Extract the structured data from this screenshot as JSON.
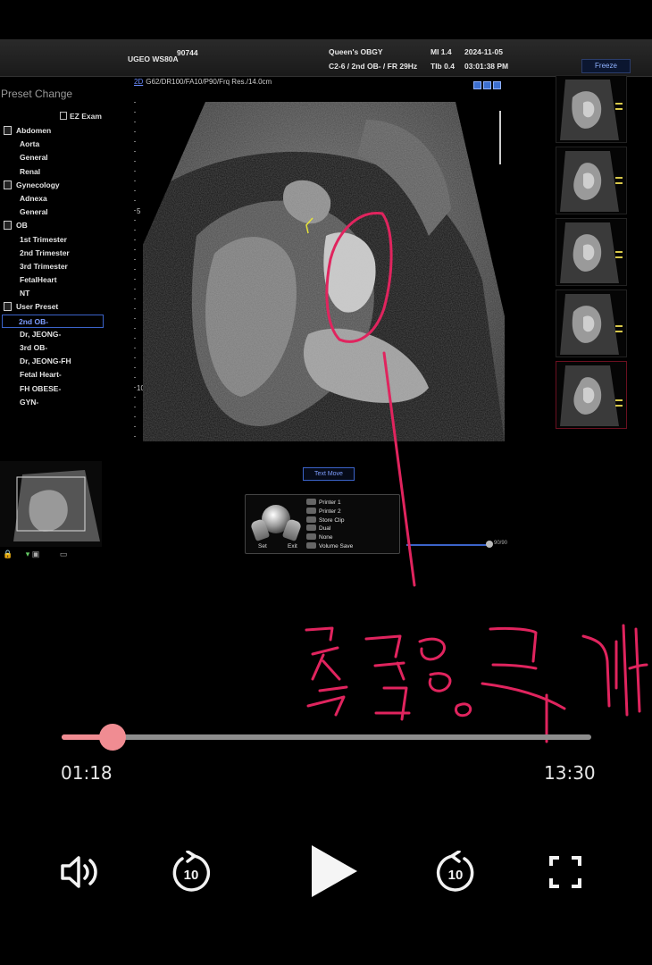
{
  "header": {
    "model": "UGEO WS80A",
    "id": "90744",
    "hospital": "Queen's OBGY",
    "probe": "C2-6 / 2nd OB- / FR 29Hz",
    "mi": "MI  1.4",
    "tib": "TIb 0.4",
    "date": "2024-11-05",
    "time": "03:01:38 PM",
    "freeze": "Freeze"
  },
  "scan": {
    "mode": "2D",
    "params": "G62/DR100/FA10/P90/Frq Res./14.0cm"
  },
  "presets": {
    "title": "Preset Change",
    "ez_exam": "EZ Exam",
    "groups": [
      {
        "label": "Abdomen",
        "items": [
          "Aorta",
          "General",
          "Renal"
        ]
      },
      {
        "label": "Gynecology",
        "items": [
          "Adnexa",
          "General"
        ]
      },
      {
        "label": "OB",
        "items": [
          "1st Trimester",
          "2nd Trimester",
          "3rd Trimester",
          "FetalHeart",
          "NT"
        ]
      },
      {
        "label": "User Preset",
        "items": [
          "2nd OB-",
          "Dr, JEONG-",
          "3rd OB-",
          "Dr, JEONG-FH",
          "Fetal Heart-",
          "FH OBESE-",
          "GYN-"
        ]
      }
    ],
    "selected": "2nd OB-"
  },
  "depth_marks": [
    "5",
    "10"
  ],
  "controls": {
    "text_move": "Text Move",
    "set": "Set",
    "exit": "Exit",
    "menu": [
      "Printer 1",
      "Printer 2",
      "Store Clip",
      "Dual",
      "None",
      "Volume Save"
    ],
    "cine_label": "90/90"
  },
  "annotation": {
    "handwritten_text": "곶감 두개",
    "color": "#e0245e"
  },
  "player": {
    "current_time": "01:18",
    "total_time": "13:30",
    "progress": 0.0963,
    "accent": "#f08c92",
    "buttons": [
      "volume-icon",
      "replay-10-icon",
      "play-icon",
      "forward-10-icon",
      "fullscreen-icon"
    ],
    "skip_seconds": "10"
  }
}
